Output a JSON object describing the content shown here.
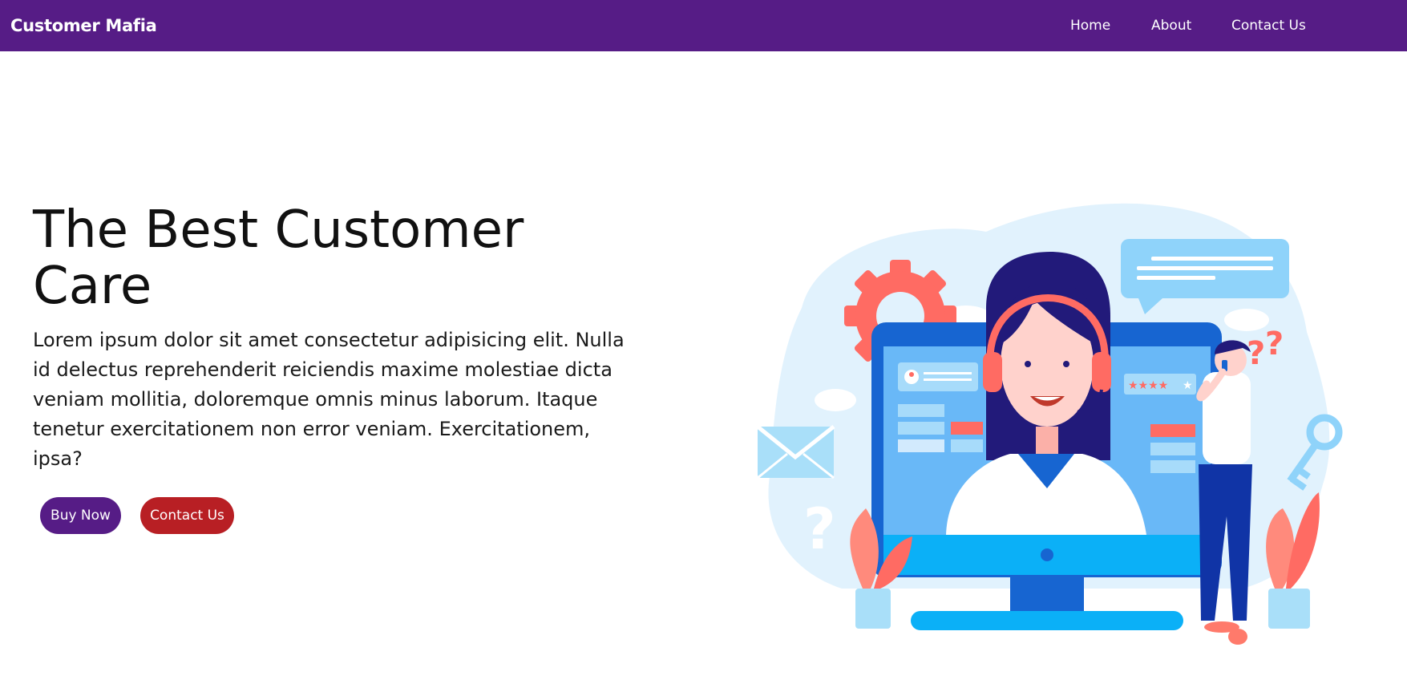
{
  "navbar": {
    "brand": "Customer Mafia",
    "links": [
      {
        "label": "Home"
      },
      {
        "label": "About"
      },
      {
        "label": "Contact Us"
      }
    ],
    "color": "#561c86"
  },
  "hero": {
    "title": "The Best Customer Care",
    "description": "Lorem ipsum dolor sit amet consectetur adipisicing elit. Nulla id delectus reprehenderit reiciendis maxime molestiae dicta veniam mollitia, doloremque omnis minus laborum. Itaque tenetur exercitationem non error veniam. Exercitationem, ipsa?",
    "buy_button": "Buy Now",
    "contact_button": "Contact Us",
    "buy_color": "#561c86",
    "contact_color": "#b81f24"
  },
  "illustration": {
    "icon": "customer-support-illustration"
  }
}
